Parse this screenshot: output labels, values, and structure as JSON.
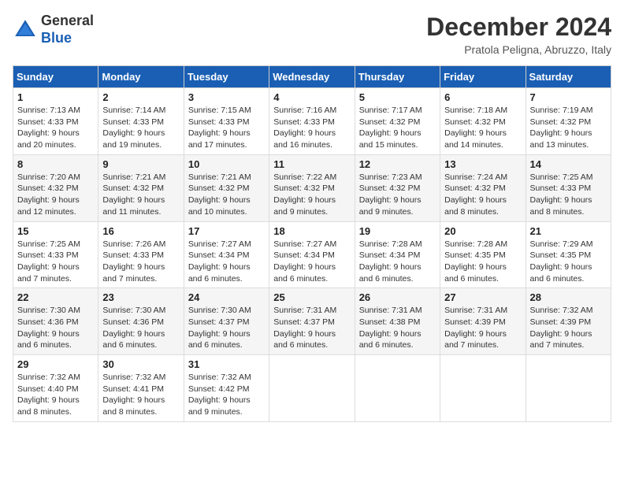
{
  "header": {
    "logo_general": "General",
    "logo_blue": "Blue",
    "month_title": "December 2024",
    "location": "Pratola Peligna, Abruzzo, Italy"
  },
  "calendar": {
    "headers": [
      "Sunday",
      "Monday",
      "Tuesday",
      "Wednesday",
      "Thursday",
      "Friday",
      "Saturday"
    ],
    "weeks": [
      [
        {
          "day": "1",
          "sunrise": "7:13 AM",
          "sunset": "4:33 PM",
          "daylight": "9 hours and 20 minutes."
        },
        {
          "day": "2",
          "sunrise": "7:14 AM",
          "sunset": "4:33 PM",
          "daylight": "9 hours and 19 minutes."
        },
        {
          "day": "3",
          "sunrise": "7:15 AM",
          "sunset": "4:33 PM",
          "daylight": "9 hours and 17 minutes."
        },
        {
          "day": "4",
          "sunrise": "7:16 AM",
          "sunset": "4:33 PM",
          "daylight": "9 hours and 16 minutes."
        },
        {
          "day": "5",
          "sunrise": "7:17 AM",
          "sunset": "4:32 PM",
          "daylight": "9 hours and 15 minutes."
        },
        {
          "day": "6",
          "sunrise": "7:18 AM",
          "sunset": "4:32 PM",
          "daylight": "9 hours and 14 minutes."
        },
        {
          "day": "7",
          "sunrise": "7:19 AM",
          "sunset": "4:32 PM",
          "daylight": "9 hours and 13 minutes."
        }
      ],
      [
        {
          "day": "8",
          "sunrise": "7:20 AM",
          "sunset": "4:32 PM",
          "daylight": "9 hours and 12 minutes."
        },
        {
          "day": "9",
          "sunrise": "7:21 AM",
          "sunset": "4:32 PM",
          "daylight": "9 hours and 11 minutes."
        },
        {
          "day": "10",
          "sunrise": "7:21 AM",
          "sunset": "4:32 PM",
          "daylight": "9 hours and 10 minutes."
        },
        {
          "day": "11",
          "sunrise": "7:22 AM",
          "sunset": "4:32 PM",
          "daylight": "9 hours and 9 minutes."
        },
        {
          "day": "12",
          "sunrise": "7:23 AM",
          "sunset": "4:32 PM",
          "daylight": "9 hours and 9 minutes."
        },
        {
          "day": "13",
          "sunrise": "7:24 AM",
          "sunset": "4:32 PM",
          "daylight": "9 hours and 8 minutes."
        },
        {
          "day": "14",
          "sunrise": "7:25 AM",
          "sunset": "4:33 PM",
          "daylight": "9 hours and 8 minutes."
        }
      ],
      [
        {
          "day": "15",
          "sunrise": "7:25 AM",
          "sunset": "4:33 PM",
          "daylight": "9 hours and 7 minutes."
        },
        {
          "day": "16",
          "sunrise": "7:26 AM",
          "sunset": "4:33 PM",
          "daylight": "9 hours and 7 minutes."
        },
        {
          "day": "17",
          "sunrise": "7:27 AM",
          "sunset": "4:34 PM",
          "daylight": "9 hours and 6 minutes."
        },
        {
          "day": "18",
          "sunrise": "7:27 AM",
          "sunset": "4:34 PM",
          "daylight": "9 hours and 6 minutes."
        },
        {
          "day": "19",
          "sunrise": "7:28 AM",
          "sunset": "4:34 PM",
          "daylight": "9 hours and 6 minutes."
        },
        {
          "day": "20",
          "sunrise": "7:28 AM",
          "sunset": "4:35 PM",
          "daylight": "9 hours and 6 minutes."
        },
        {
          "day": "21",
          "sunrise": "7:29 AM",
          "sunset": "4:35 PM",
          "daylight": "9 hours and 6 minutes."
        }
      ],
      [
        {
          "day": "22",
          "sunrise": "7:30 AM",
          "sunset": "4:36 PM",
          "daylight": "9 hours and 6 minutes."
        },
        {
          "day": "23",
          "sunrise": "7:30 AM",
          "sunset": "4:36 PM",
          "daylight": "9 hours and 6 minutes."
        },
        {
          "day": "24",
          "sunrise": "7:30 AM",
          "sunset": "4:37 PM",
          "daylight": "9 hours and 6 minutes."
        },
        {
          "day": "25",
          "sunrise": "7:31 AM",
          "sunset": "4:37 PM",
          "daylight": "9 hours and 6 minutes."
        },
        {
          "day": "26",
          "sunrise": "7:31 AM",
          "sunset": "4:38 PM",
          "daylight": "9 hours and 6 minutes."
        },
        {
          "day": "27",
          "sunrise": "7:31 AM",
          "sunset": "4:39 PM",
          "daylight": "9 hours and 7 minutes."
        },
        {
          "day": "28",
          "sunrise": "7:32 AM",
          "sunset": "4:39 PM",
          "daylight": "9 hours and 7 minutes."
        }
      ],
      [
        {
          "day": "29",
          "sunrise": "7:32 AM",
          "sunset": "4:40 PM",
          "daylight": "9 hours and 8 minutes."
        },
        {
          "day": "30",
          "sunrise": "7:32 AM",
          "sunset": "4:41 PM",
          "daylight": "9 hours and 8 minutes."
        },
        {
          "day": "31",
          "sunrise": "7:32 AM",
          "sunset": "4:42 PM",
          "daylight": "9 hours and 9 minutes."
        },
        null,
        null,
        null,
        null
      ]
    ]
  }
}
